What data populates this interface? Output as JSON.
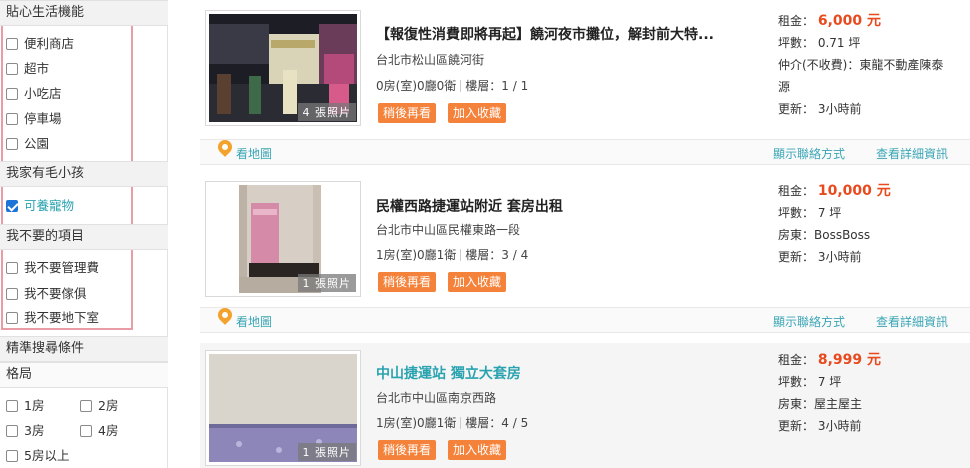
{
  "sidebar": {
    "sections": [
      {
        "title": "貼心生活機能",
        "options": [
          {
            "label": "便利商店",
            "checked": false
          },
          {
            "label": "超市",
            "checked": false
          },
          {
            "label": "小吃店",
            "checked": false
          },
          {
            "label": "停車場",
            "checked": false
          },
          {
            "label": "公園",
            "checked": false
          }
        ]
      },
      {
        "title": "我家有毛小孩",
        "options": [
          {
            "label": "可養寵物",
            "checked": true
          }
        ]
      },
      {
        "title": "我不要的項目",
        "options": [
          {
            "label": "我不要管理費",
            "checked": false
          },
          {
            "label": "我不要傢俱",
            "checked": false
          },
          {
            "label": "我不要地下室",
            "checked": false
          }
        ]
      }
    ],
    "precise_title": "精準搜尋條件",
    "layout_title": "格局",
    "layout_options": [
      "1房",
      "2房",
      "3房",
      "4房",
      "5房以上"
    ]
  },
  "listings": [
    {
      "title": "【報復性消費即將再起】饒河夜市攤位，解封前大特...",
      "address": "台北市松山區饒河街",
      "rooms": "0房(室)0廳0衛",
      "floor": "樓層：1 / 1",
      "photos": "4 張照片",
      "rent_label": "租金：",
      "rent": "6,000 元",
      "area": "坪數： 0.71 坪",
      "agent_line1": "仲介(不收費)：東龍不動產陳泰",
      "agent_line2": "源",
      "updated": "更新： 3小時前"
    },
    {
      "title": "民權西路捷運站附近 套房出租",
      "address": "台北市中山區民權東路一段",
      "rooms": "1房(室)0廳1衛",
      "floor": "樓層：3 / 4",
      "photos": "1 張照片",
      "rent_label": "租金：",
      "rent": "10,000 元",
      "area": "坪數： 7 坪",
      "agent_line1": "房東：BossBoss",
      "updated": "更新： 3小時前"
    },
    {
      "title": "中山捷運站 獨立大套房",
      "address": "台北市中山區南京西路",
      "rooms": "1房(室)0廳1衛",
      "floor": "樓層：4 / 5",
      "photos": "1 張照片",
      "rent_label": "租金：",
      "rent": "8,999 元",
      "area": "坪數： 7 坪",
      "agent_line1": "房東：屋主屋主",
      "updated": "更新： 3小時前"
    }
  ],
  "actions": {
    "later": "稍後再看",
    "favorite": "加入收藏",
    "map": "看地圖",
    "contact": "顯示聯絡方式",
    "detail": "查看詳細資訊"
  },
  "colors": {
    "accent_orange": "#f5823a",
    "price_red": "#e8491d",
    "link_teal": "#3aa5b4",
    "highlight_pink": "#e99ba6"
  }
}
